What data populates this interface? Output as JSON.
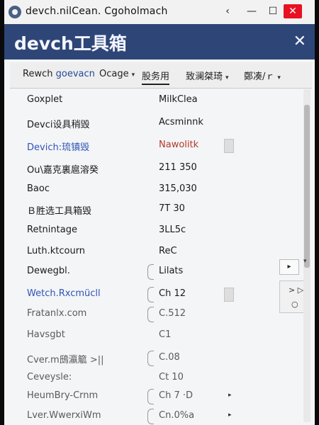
{
  "window": {
    "title": "devch.nilCean. Cgoholmach",
    "controls": {
      "back": "‹",
      "expand": "⤢",
      "minimize": "—",
      "maximize": "☐",
      "close": "✕"
    }
  },
  "header": {
    "app_title": "devch工具箱",
    "close": "✕"
  },
  "toolbar": {
    "item1_a": "Rewch ",
    "item1_b": "goevacn",
    "item2": "Ocage",
    "item3": "股务用",
    "item4": "致澜桀琦",
    "item5": "鄭凑/ｒ",
    "arrow": "▾"
  },
  "rows": [
    {
      "name": "Goxplet",
      "value": "MilkClea"
    },
    {
      "name": "Devci设具稍毁",
      "value": "Acsminnk"
    },
    {
      "name": "Devich:琉镇毁",
      "value": "Nawolitk"
    },
    {
      "name": "Ou\\嘉克裏扈溶癸",
      "value": "211 350"
    },
    {
      "name": "Baoc",
      "value": "315,030"
    },
    {
      "name": "Ｂ胜选工具箱毁",
      "value": "7T  30"
    },
    {
      "name": "Retnintage",
      "value": "3LL5c"
    },
    {
      "name": "Luth.ktcourn",
      "value": "ReC"
    },
    {
      "name": "Dewegbl.",
      "value": "Lilats"
    },
    {
      "name": "Wetch.Rxcmücll",
      "value": "Ch 12"
    },
    {
      "name": "Fratanlx.com",
      "value": "C.512"
    },
    {
      "name": "Havsgbt",
      "value": "C1"
    },
    {
      "name": "Cver.m䲭瀛䉉  >||",
      "value": "C.08"
    },
    {
      "name": "Ceveysle:",
      "value": "Ct 10"
    },
    {
      "name": "HeumBry-Crnm",
      "value": "Ch 7  ·D"
    },
    {
      "name": "Lver.WwerxiWm",
      "value": "Cn.0%a"
    }
  ],
  "side": {
    "play": "▸",
    "skip": "> ▷",
    "circle": "○",
    "dot": "▸"
  },
  "colors": {
    "header_bg": "#2e4677",
    "link": "#2f54b8",
    "alert": "#b23a2a",
    "close_button": "#e81123"
  }
}
